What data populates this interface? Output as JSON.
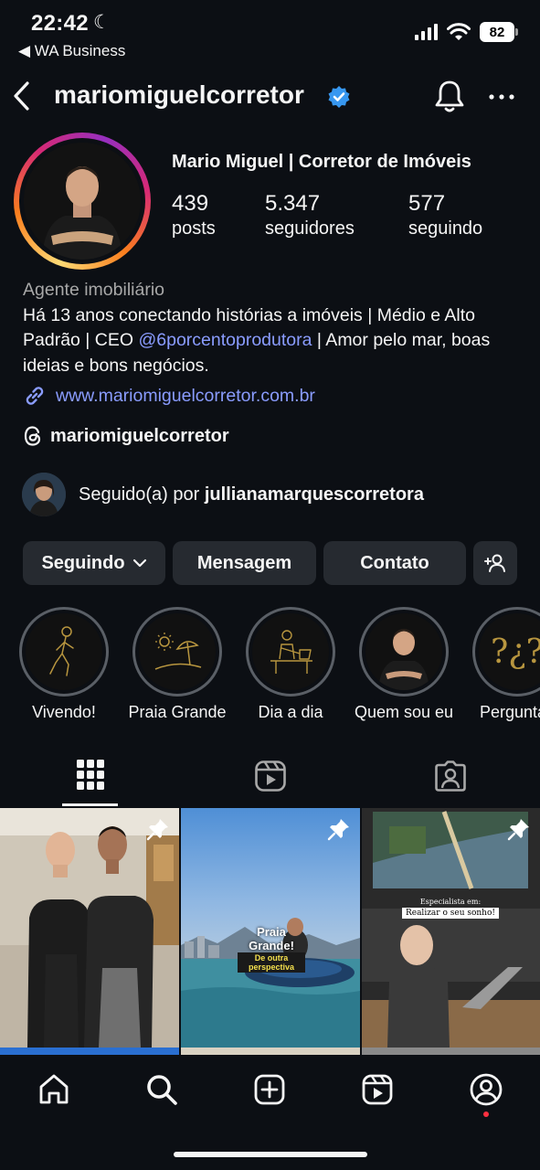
{
  "status_bar": {
    "time": "22:42",
    "back_app": "◀ WA Business",
    "battery": "82"
  },
  "header": {
    "username": "mariomiguelcorretor"
  },
  "profile": {
    "full_name": "Mario Miguel | Corretor de Imóveis",
    "stats": {
      "posts_count": "439",
      "posts_label": "posts",
      "followers_count": "5.347",
      "followers_label": "seguidores",
      "following_count": "577",
      "following_label": "seguindo"
    },
    "category": "Agente imobiliário",
    "bio_part1": "Há 13 anos conectando histórias a imóveis | Médio e Alto Padrão | CEO ",
    "bio_mention": "@6porcentoprodutora",
    "bio_part2": " | Amor pelo mar, boas ideias e bons negócios.",
    "link": "www.mariomiguelcorretor.com.br",
    "threads_handle": "mariomiguelcorretor",
    "followed_by_prefix": "Seguido(a) por ",
    "followed_by_name": "jullianamarquescorretora"
  },
  "actions": {
    "following": "Seguindo",
    "message": "Mensagem",
    "contact": "Contato"
  },
  "highlights": [
    {
      "label": "Vivendo!"
    },
    {
      "label": "Praia Grande"
    },
    {
      "label": "Dia a dia"
    },
    {
      "label": "Quem sou eu"
    },
    {
      "label": "Perguntas"
    }
  ],
  "posts": [
    {
      "overlay": ""
    },
    {
      "overlay_title": "Praia Grande!",
      "overlay_sub": "De outra perspectiva"
    },
    {
      "overlay_top": "Especialista em:",
      "overlay_main": "Realizar o seu sonho!"
    }
  ],
  "colors": {
    "background": "#0c0f14",
    "link": "#8a9cff",
    "button": "#262a30",
    "verified": "#3797f0",
    "notification_dot": "#ff3040"
  }
}
